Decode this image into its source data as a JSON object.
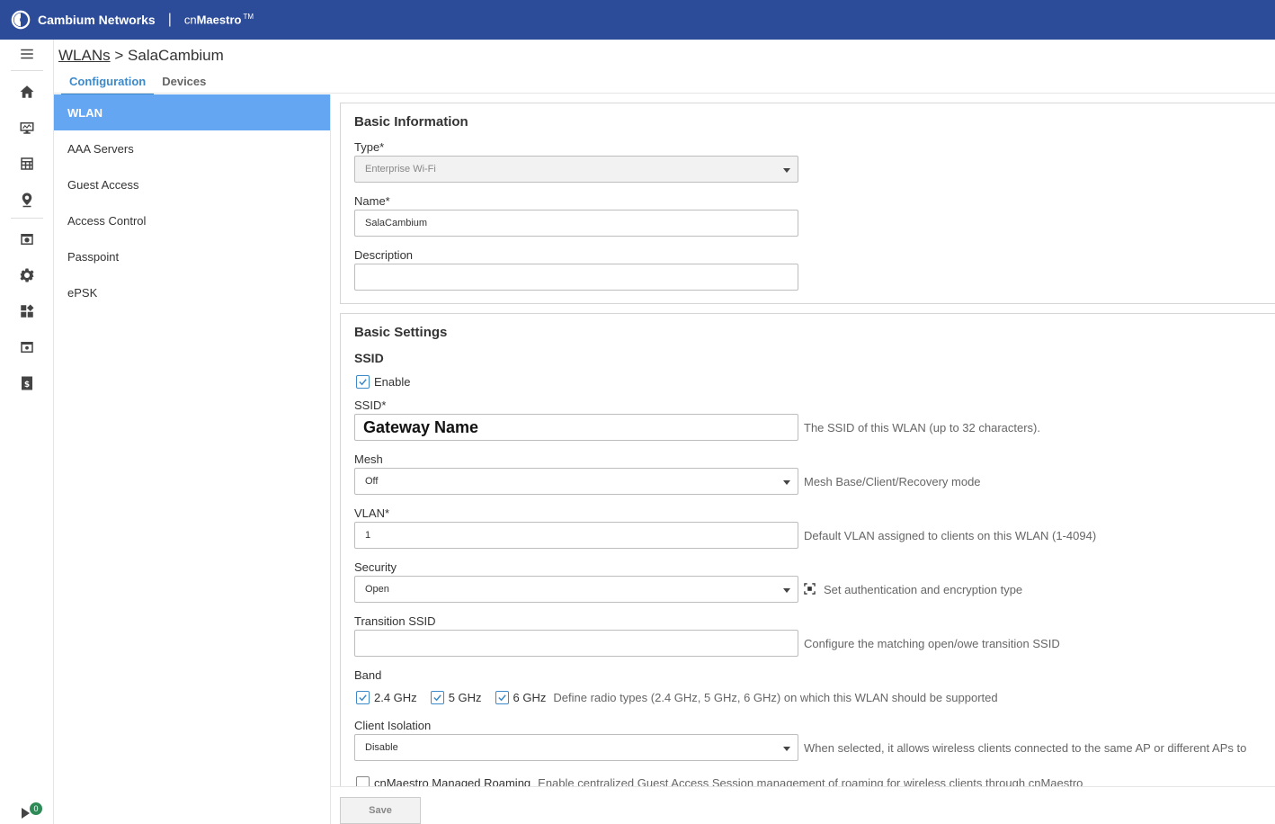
{
  "header": {
    "brand": "Cambium Networks",
    "separator": "|",
    "product_prefix": "cn",
    "product_name": "Maestro",
    "product_tm": "TM"
  },
  "rail": {
    "badge_count": "0"
  },
  "breadcrumb": {
    "parent": "WLANs",
    "sep": ">",
    "current": "SalaCambium"
  },
  "tabs": [
    {
      "label": "Configuration",
      "active": true
    },
    {
      "label": "Devices",
      "active": false
    }
  ],
  "subnav": {
    "items": [
      "WLAN",
      "AAA Servers",
      "Guest Access",
      "Access Control",
      "Passpoint",
      "ePSK"
    ]
  },
  "basic_info": {
    "title": "Basic Information",
    "type_label": "Type*",
    "type_value": "Enterprise Wi-Fi",
    "name_label": "Name*",
    "name_value": "SalaCambium",
    "description_label": "Description",
    "description_value": ""
  },
  "basic_settings": {
    "title": "Basic Settings",
    "ssid_section": "SSID",
    "enable_label": "Enable",
    "ssid_label": "SSID*",
    "ssid_value": "Gateway Name",
    "ssid_hint": "The SSID of this WLAN (up to 32 characters).",
    "mesh_label": "Mesh",
    "mesh_value": "Off",
    "mesh_hint": "Mesh Base/Client/Recovery mode",
    "vlan_label": "VLAN*",
    "vlan_value": "1",
    "vlan_hint": "Default VLAN assigned to clients on this WLAN (1-4094)",
    "security_label": "Security",
    "security_value": "Open",
    "security_hint": "Set authentication and encryption type",
    "transition_label": "Transition SSID",
    "transition_value": "",
    "transition_hint": "Configure the matching open/owe transition SSID",
    "band_label": "Band",
    "bands": [
      "2.4 GHz",
      "5 GHz",
      "6 GHz"
    ],
    "band_hint": "Define radio types (2.4 GHz, 5 GHz, 6 GHz) on which this WLAN should be supported",
    "isolation_label": "Client Isolation",
    "isolation_value": "Disable",
    "isolation_hint": "When selected, it allows wireless clients connected to the same AP or different APs to",
    "roaming_label": "cnMaestro Managed Roaming",
    "roaming_hint": "Enable centralized Guest Access Session management of roaming for wireless clients through cnMaestro"
  },
  "footer": {
    "save_label": "Save"
  }
}
